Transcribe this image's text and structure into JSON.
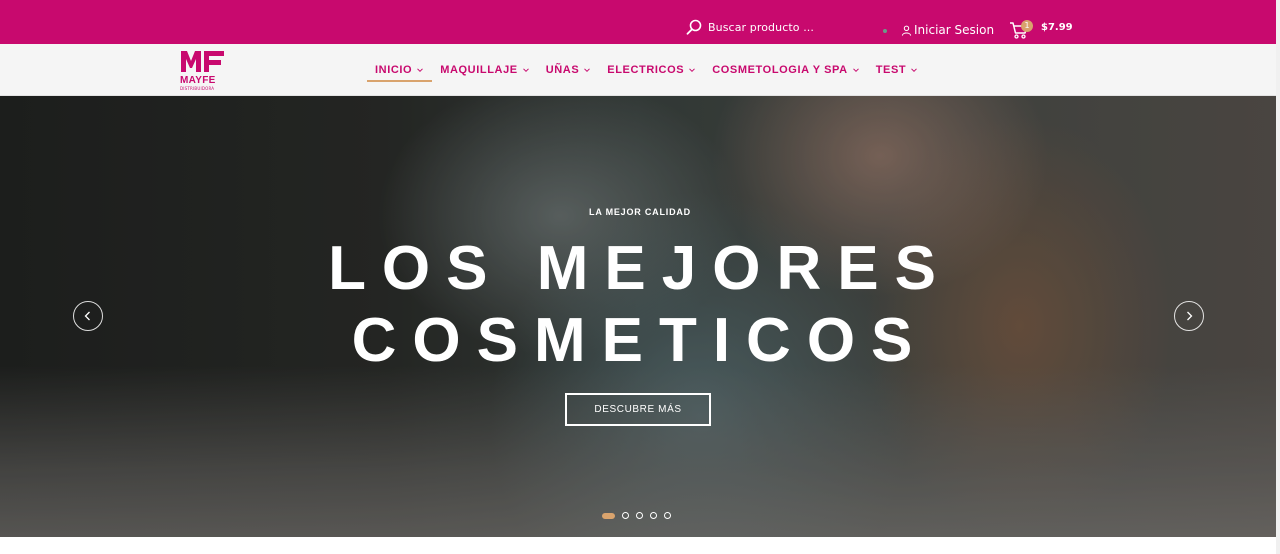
{
  "header": {
    "search_placeholder": "Buscar producto ...",
    "login_label": "Iniciar Sesion",
    "cart_count": "1",
    "cart_total": "$7.99"
  },
  "brand": {
    "name": "MAYFE",
    "subtitle": "DISTRIBUIDORA",
    "color": "#c8096e",
    "accent": "#d9a36d"
  },
  "nav": {
    "items": [
      {
        "label": "INICIO",
        "active": true
      },
      {
        "label": "MAQUILLAJE",
        "active": false
      },
      {
        "label": "UÑAS",
        "active": false
      },
      {
        "label": "ELECTRICOS",
        "active": false
      },
      {
        "label": "COSMETOLOGIA Y SPA",
        "active": false
      },
      {
        "label": "TEST",
        "active": false
      }
    ]
  },
  "hero": {
    "kicker": "LA MEJOR CALIDAD",
    "headline_line1": "LOS MEJORES",
    "headline_line2": "COSMETICOS",
    "cta_label": "DESCUBRE MÁS",
    "slide_count": 5,
    "active_slide": 1
  },
  "icons": {
    "search": "search-icon",
    "user": "user-icon",
    "cart": "cart-icon",
    "prev": "chevron-left-icon",
    "next": "chevron-right-icon",
    "dropdown": "chevron-down-icon"
  }
}
